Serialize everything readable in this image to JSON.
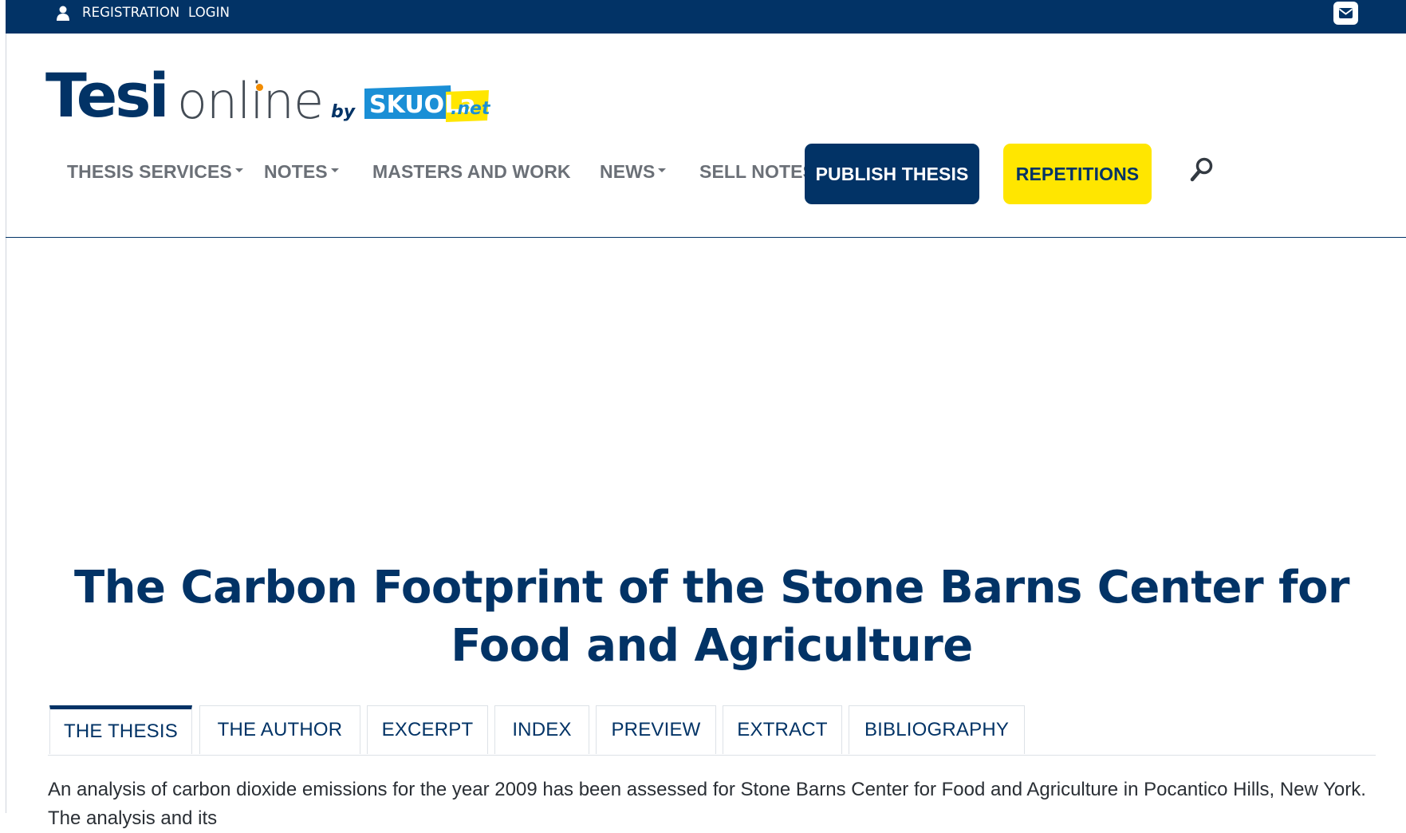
{
  "topbar": {
    "registration_label": "REGISTRATION",
    "login_label": "LOGIN",
    "user_icon": "user-icon",
    "mail_icon": "envelope-icon",
    "background_color": "#023366"
  },
  "logo": {
    "tesi": "Tesi",
    "online": "online",
    "by": "by",
    "skuola": "SKUOLa",
    "net": ".net"
  },
  "nav": {
    "items": [
      {
        "label": "THESIS SERVICES",
        "has_dropdown": true
      },
      {
        "label": "NOTES",
        "has_dropdown": true
      },
      {
        "label": "MASTERS AND WORK",
        "has_dropdown": false
      },
      {
        "label": "NEWS",
        "has_dropdown": true
      },
      {
        "label": "SELL NOTES",
        "has_dropdown": false
      }
    ],
    "publish_label": "PUBLISH THESIS",
    "repetitions_label": "REPETITIONS",
    "search_icon": "search-icon",
    "accent_color": "#023366",
    "highlight_color": "#ffe600"
  },
  "main": {
    "title": "The Carbon Footprint of the Stone Barns Center for Food and Agriculture",
    "tabs": [
      {
        "label": "THE THESIS",
        "active": true
      },
      {
        "label": "THE AUTHOR",
        "active": false
      },
      {
        "label": "EXCERPT",
        "active": false
      },
      {
        "label": "INDEX",
        "active": false
      },
      {
        "label": "PREVIEW",
        "active": false
      },
      {
        "label": "EXTRACT",
        "active": false
      },
      {
        "label": "BIBLIOGRAPHY",
        "active": false
      }
    ],
    "abstract": "An analysis of carbon dioxide emissions for the year 2009 has been assessed for Stone Barns Center for Food and Agriculture in Pocantico Hills, New York. The analysis and its"
  }
}
